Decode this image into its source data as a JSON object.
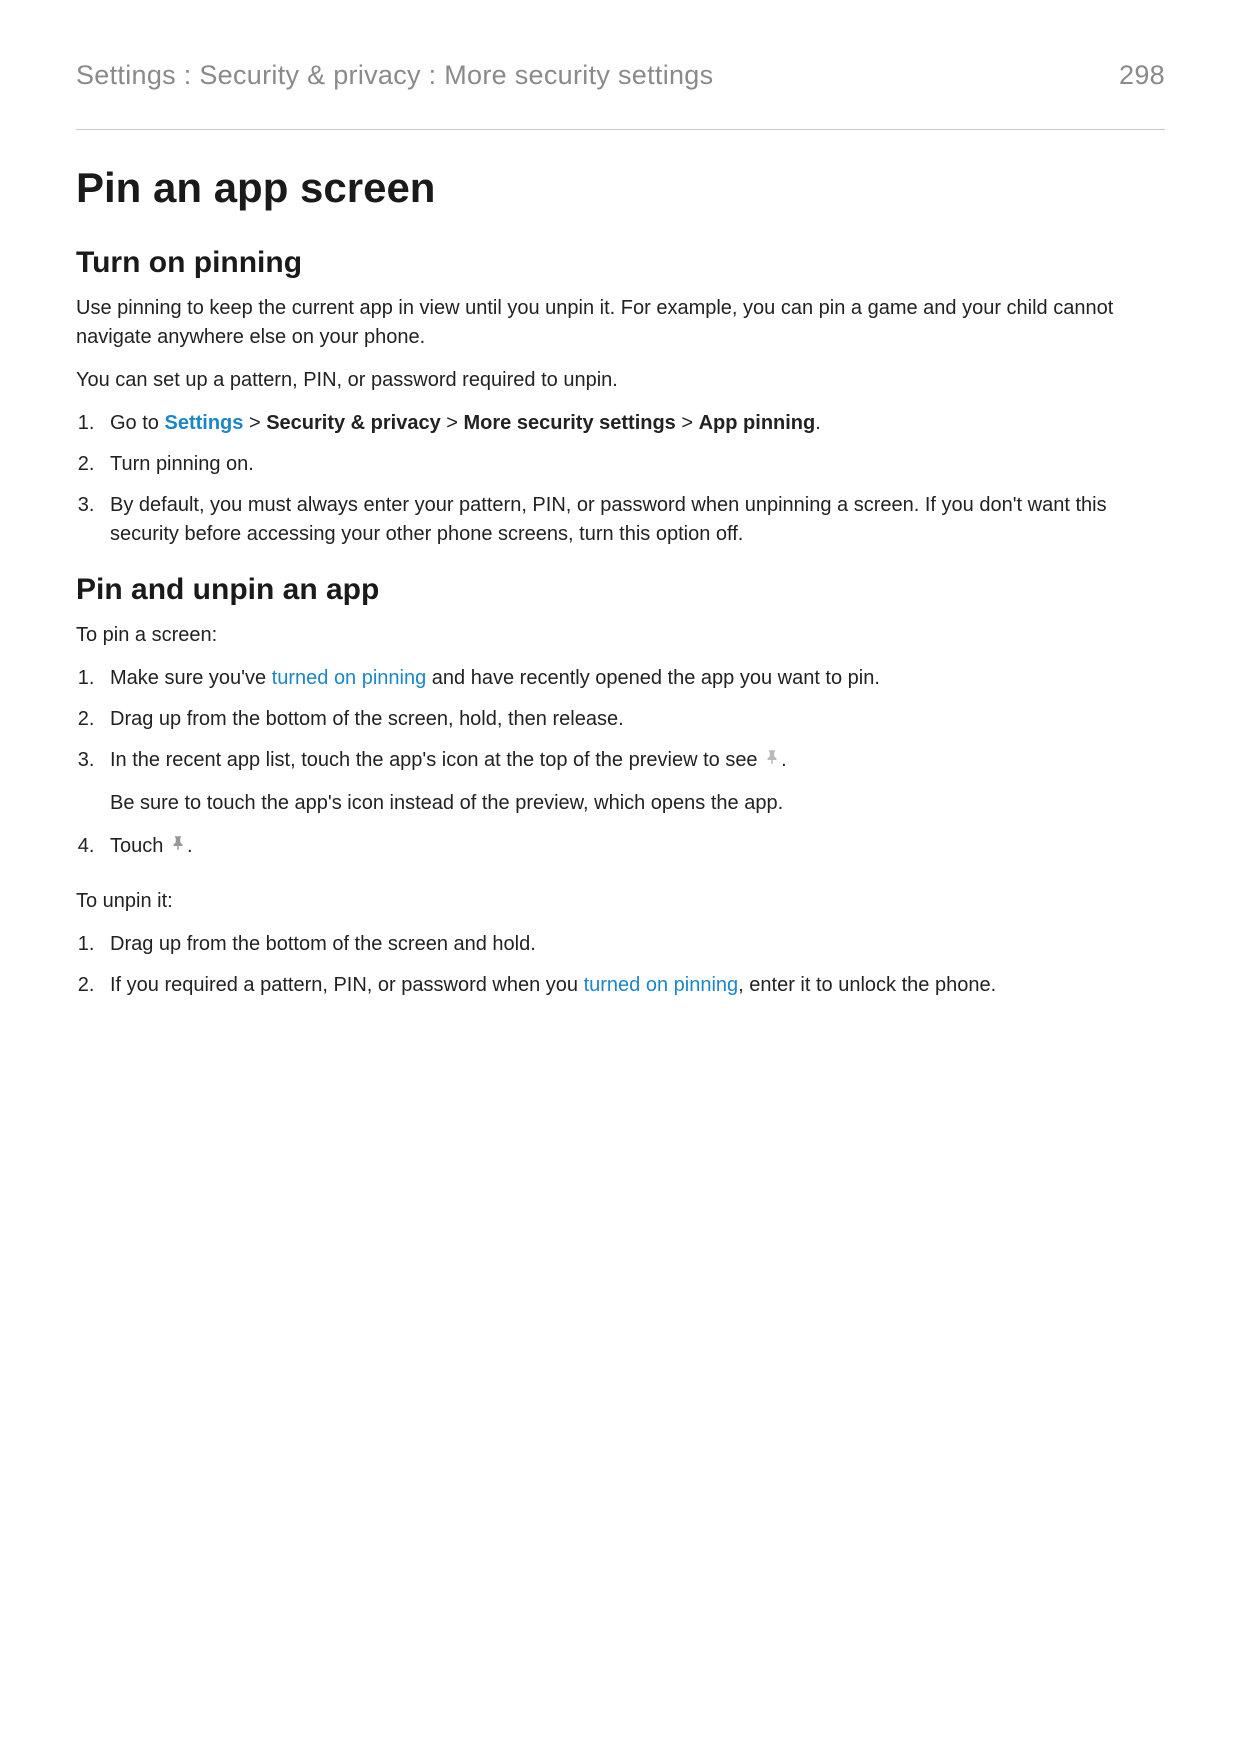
{
  "header": {
    "breadcrumb": "Settings : Security & privacy : More security settings",
    "page_number": "298"
  },
  "page_title": "Pin an app screen",
  "section1": {
    "title": "Turn on pinning",
    "p1": "Use pinning to keep the current app in view until you unpin it. For example, you can pin a game and your child cannot navigate anywhere else on your phone.",
    "p2": "You can set up a pattern, PIN, or password required to unpin.",
    "step1": {
      "pre": "Go to ",
      "settings_link": "Settings",
      "sep": " > ",
      "b1": "Security & privacy",
      "b2": "More security settings",
      "b3": "App pinning",
      "period": "."
    },
    "step2": "Turn pinning on.",
    "step3": "By default, you must always enter your pattern, PIN, or password when unpinning a screen. If you don't want this security before accessing your other phone screens, turn this option off."
  },
  "section2": {
    "title": "Pin and unpin an app",
    "pin_intro": "To pin a screen:",
    "pin_step1": {
      "pre": "Make sure you've ",
      "link": "turned on pinning",
      "post": " and have recently opened the app you want to pin."
    },
    "pin_step2": "Drag up from the bottom of the screen, hold, then release.",
    "pin_step3": {
      "line": "In the recent app list, touch the app's icon at the top of the preview to see ",
      "period": ".",
      "sub": "Be sure to touch the app's icon instead of the preview, which opens the app."
    },
    "pin_step4": {
      "pre": "Touch ",
      "period": "."
    },
    "unpin_intro": "To unpin it:",
    "unpin_step1": "Drag up from the bottom of the screen and hold.",
    "unpin_step2": {
      "pre": "If you required a pattern, PIN, or password when you ",
      "link": "turned on pinning",
      "post": ", enter it to unlock the phone."
    }
  }
}
